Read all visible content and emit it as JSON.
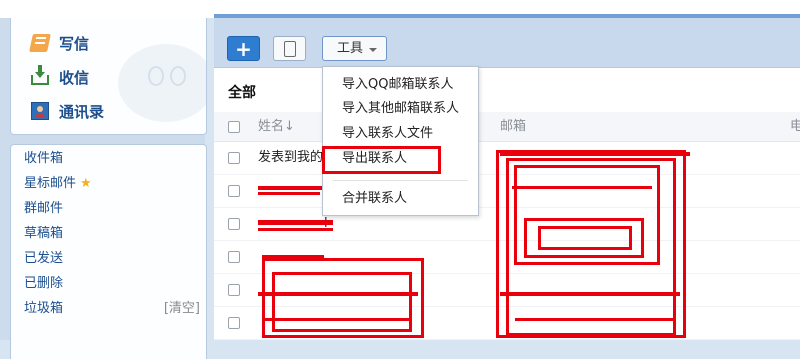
{
  "sidebar": {
    "quick": [
      {
        "label": "写信",
        "icon": "write-icon"
      },
      {
        "label": "收信",
        "icon": "inbox-icon"
      },
      {
        "label": "通讯录",
        "icon": "contacts-icon"
      }
    ],
    "folders": [
      {
        "label": "收件箱"
      },
      {
        "label": "星标邮件",
        "icon": "star-icon",
        "icon_char": "★"
      },
      {
        "label": "群邮件"
      },
      {
        "label": "草稿箱"
      },
      {
        "label": "已发送"
      },
      {
        "label": "已删除"
      },
      {
        "label": "垃圾箱",
        "action": "[清空]"
      }
    ]
  },
  "toolbar": {
    "add_label": "+",
    "tools_label": "工具"
  },
  "main": {
    "heading": "全部",
    "columns": {
      "name": "姓名↓",
      "email": "邮箱",
      "phone": "电"
    },
    "rows": [
      {
        "name": "发表到我的"
      },
      {
        "name": ""
      },
      {
        "name": "l"
      },
      {
        "name": ""
      },
      {
        "name": ""
      },
      {
        "name": ""
      }
    ]
  },
  "tools_menu": {
    "items": [
      "导入QQ邮箱联系人",
      "导入其他邮箱联系人",
      "导入联系人文件",
      "导出联系人",
      "合并联系人"
    ],
    "highlighted": "导出联系人"
  },
  "colors": {
    "accent": "#2f7dd0",
    "annotation_red": "#e8000c",
    "sidebar_link": "#1d4f8f",
    "star": "#f2b01e"
  }
}
